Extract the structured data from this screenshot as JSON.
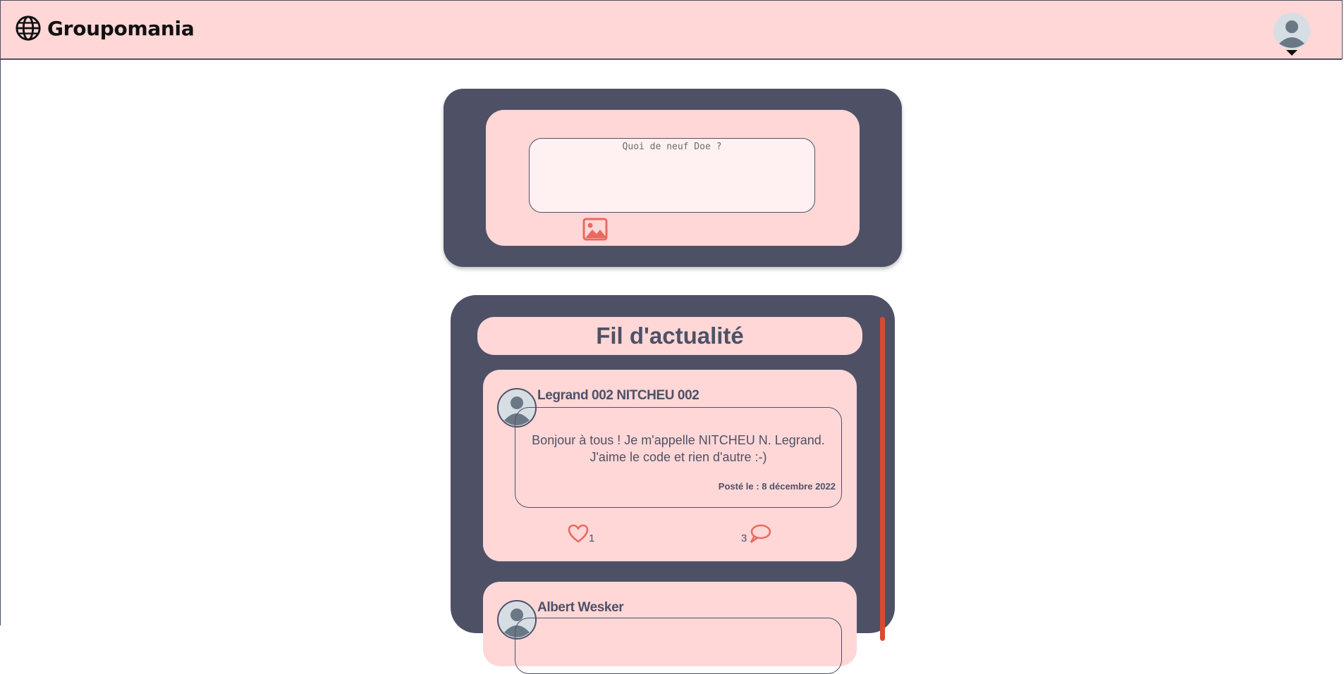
{
  "app": {
    "brand": "Groupomania"
  },
  "composer": {
    "placeholder": "Quoi de neuf Doe ?"
  },
  "feed": {
    "title": "Fil d'actualité",
    "posts": [
      {
        "author": "Legrand 002 NITCHEU 002",
        "text": "Bonjour à tous ! Je m'appelle NITCHEU N. Legrand. J'aime le code et rien d'autre :-)",
        "date": "Posté le : 8 décembre 2022",
        "likes": "1",
        "comments": "3"
      },
      {
        "author": "Albert Wesker"
      }
    ]
  },
  "colors": {
    "header_bg": "#ffd7d7",
    "panel_dark": "#4e5166",
    "accent": "#fd2d01",
    "icon_red": "#e86a5f"
  },
  "icons": {
    "brand": "globe-icon",
    "profile": "user-avatar-icon",
    "image_upload": "image-icon",
    "like": "heart-icon",
    "comment": "speech-bubble-icon"
  }
}
